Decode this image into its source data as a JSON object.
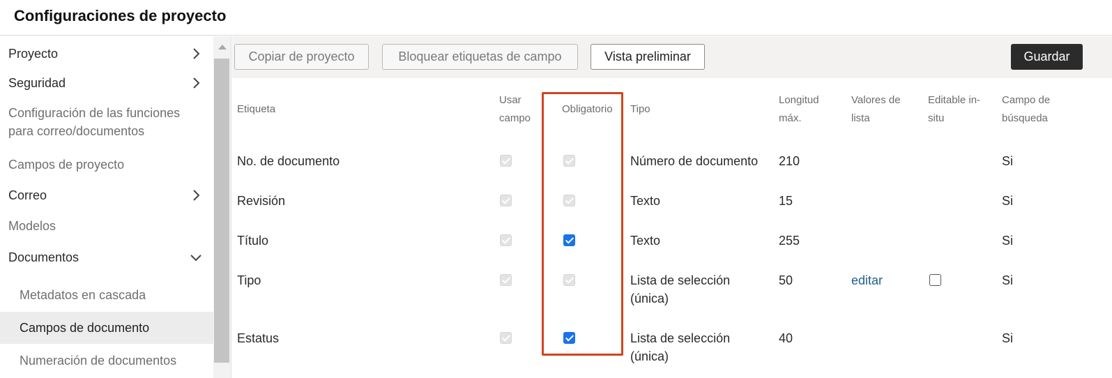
{
  "page": {
    "title": "Configuraciones de proyecto"
  },
  "sidebar": {
    "items": [
      {
        "label": "Proyecto",
        "chevron": "chevron-right"
      },
      {
        "label": "Seguridad",
        "chevron": "chevron-right"
      },
      {
        "label": "Configuración de las funciones",
        "label2": "para correo/documentos"
      },
      {
        "label": "Campos de proyecto"
      },
      {
        "label": "Correo",
        "chevron": "chevron-right"
      },
      {
        "label": "Modelos"
      },
      {
        "label": "Documentos",
        "chevron": "chevron-down"
      }
    ],
    "subitems": [
      {
        "label": "Metadatos en cascada"
      },
      {
        "label": "Campos de documento",
        "active": true
      },
      {
        "label": "Numeración de documentos"
      }
    ]
  },
  "toolbar": {
    "copy_label": "Copiar de proyecto",
    "lock_label": "Bloquear etiquetas de campo",
    "preview_label": "Vista preliminar",
    "save_label": "Guardar"
  },
  "table": {
    "headers": {
      "label": "Etiqueta",
      "use_1": "Usar",
      "use_2": "campo",
      "required": "Obligatorio",
      "type": "Tipo",
      "maxlen_1": "Longitud",
      "maxlen_2": "máx.",
      "listvals_1": "Valores de",
      "listvals_2": "lista",
      "editable_1": "Editable in-",
      "editable_2": "situ",
      "search_1": "Campo de",
      "search_2": "búsqueda"
    },
    "rows": [
      {
        "label": "No. de documento",
        "use": "disabled-checked",
        "required": "disabled-checked",
        "type": "Número de documento",
        "maxlen": "210",
        "list": "",
        "editable": "",
        "search": "Si"
      },
      {
        "label": "Revisión",
        "use": "disabled-checked",
        "required": "disabled-checked",
        "type": "Texto",
        "maxlen": "15",
        "list": "",
        "editable": "",
        "search": "Si"
      },
      {
        "label": "Título",
        "use": "disabled-checked",
        "required": "checked",
        "type": "Texto",
        "maxlen": "255",
        "list": "",
        "editable": "",
        "search": "Si"
      },
      {
        "label": "Tipo",
        "use": "disabled-checked",
        "required": "disabled-checked",
        "type": "Lista de selección",
        "type2": "(única)",
        "maxlen": "50",
        "list": "editar",
        "editable": "unchecked",
        "search": "Si"
      },
      {
        "label": "Estatus",
        "use": "disabled-checked",
        "required": "checked",
        "type": "Lista de selección",
        "type2": "(única)",
        "maxlen": "40",
        "list": "",
        "editable": "",
        "search": "Si"
      }
    ]
  },
  "colors": {
    "highlight": "#d2431f",
    "checkbox_checked": "#1a73e8",
    "link": "#1f5f8b",
    "primary_button": "#2b2b2b"
  }
}
